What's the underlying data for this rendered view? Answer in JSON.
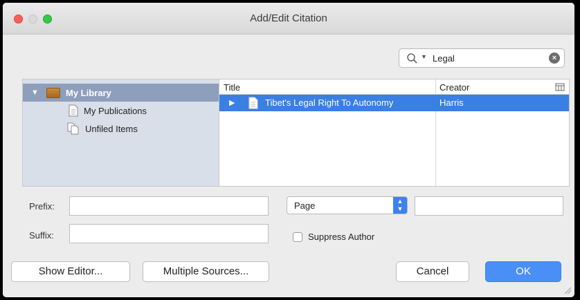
{
  "window": {
    "title": "Add/Edit Citation"
  },
  "search": {
    "query": "Legal",
    "placeholder": ""
  },
  "collections": [
    {
      "label": "My Library",
      "selected": true,
      "icon": "library-icon"
    },
    {
      "label": "My Publications",
      "selected": false,
      "icon": "document-icon"
    },
    {
      "label": "Unfiled Items",
      "selected": false,
      "icon": "unfiled-icon"
    }
  ],
  "items_table": {
    "columns": {
      "title": "Title",
      "creator": "Creator"
    },
    "rows": [
      {
        "title": "Tibet's Legal Right To Autonomy",
        "creator": "Harris",
        "selected": true
      }
    ]
  },
  "form": {
    "prefix_label": "Prefix:",
    "suffix_label": "Suffix:",
    "prefix_value": "",
    "suffix_value": "",
    "locator_type": "Page",
    "locator_value": "",
    "suppress_author_label": "Suppress Author",
    "suppress_author_checked": false
  },
  "buttons": {
    "show_editor": "Show Editor...",
    "multiple_sources": "Multiple Sources...",
    "cancel": "Cancel",
    "ok": "OK"
  },
  "colors": {
    "selection": "#3a7fe3",
    "sidebar": "#d9dfe8",
    "sidebar_selected": "#8e9fbc"
  }
}
